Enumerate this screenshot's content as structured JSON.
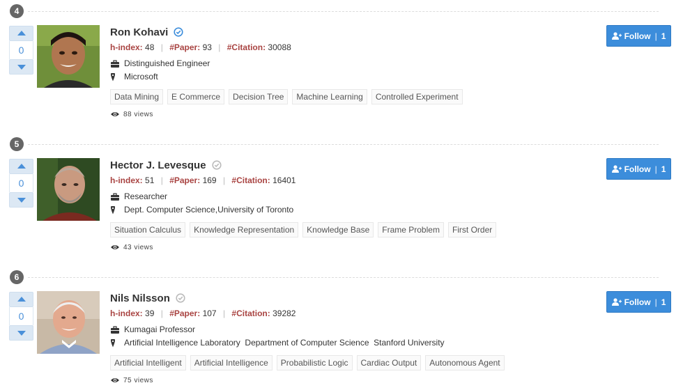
{
  "entries": [
    {
      "rank": "4",
      "votes": "0",
      "name": "Ron Kohavi",
      "verified": true,
      "stats": {
        "hindex_label": "h-index:",
        "hindex": "48",
        "paper_label": "#Paper:",
        "paper": "93",
        "citation_label": "#Citation:",
        "citation": "30088"
      },
      "position": "Distinguished Engineer",
      "affiliation": "Microsoft",
      "tags": [
        "Data Mining",
        "E Commerce",
        "Decision Tree",
        "Machine Learning",
        "Controlled Experiment"
      ],
      "views": "88 views",
      "follow_label": "Follow",
      "follow_count": "1"
    },
    {
      "rank": "5",
      "votes": "0",
      "name": "Hector J. Levesque",
      "verified": false,
      "stats": {
        "hindex_label": "h-index:",
        "hindex": "51",
        "paper_label": "#Paper:",
        "paper": "169",
        "citation_label": "#Citation:",
        "citation": "16401"
      },
      "position": "Researcher",
      "affiliation": "Dept. Computer Science,University of Toronto",
      "tags": [
        "Situation Calculus",
        "Knowledge Representation",
        "Knowledge Base",
        "Frame Problem",
        "First Order"
      ],
      "views": "43 views",
      "follow_label": "Follow",
      "follow_count": "1"
    },
    {
      "rank": "6",
      "votes": "0",
      "name": "Nils Nilsson",
      "verified": false,
      "stats": {
        "hindex_label": "h-index:",
        "hindex": "39",
        "paper_label": "#Paper:",
        "paper": "107",
        "citation_label": "#Citation:",
        "citation": "39282"
      },
      "position": "Kumagai Professor",
      "affiliation": "Artificial Intelligence Laboratory  Department of Computer Science  Stanford University",
      "tags": [
        "Artificial Intelligent",
        "Artificial Intelligence",
        "Probabilistic Logic",
        "Cardiac Output",
        "Autonomous Agent"
      ],
      "views": "75 views",
      "follow_label": "Follow",
      "follow_count": "1"
    }
  ],
  "icons": {
    "vote_up": "triangle-up-icon",
    "vote_down": "triangle-down-icon",
    "verified": "check-circle-icon",
    "position": "briefcase-icon",
    "affiliation": "map-marker-icon",
    "views": "eye-icon",
    "follow": "user-plus-icon"
  },
  "colors": {
    "accent": "#3c8ddb",
    "stat_label": "#a94442",
    "verified_active": "#3c8ddb",
    "verified_inactive": "#bbbbbb",
    "rank_badge": "#666666"
  }
}
